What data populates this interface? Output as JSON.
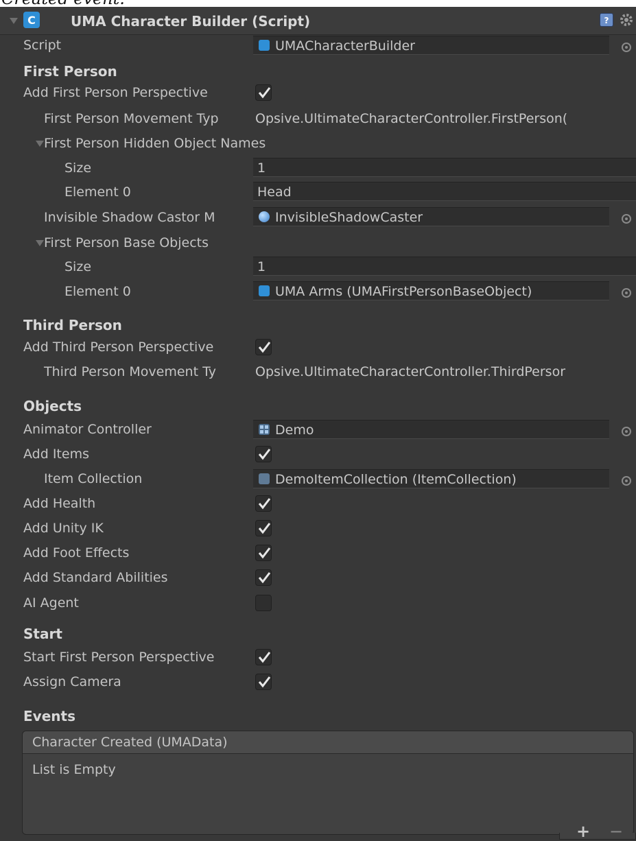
{
  "caption": "Created event.",
  "header": {
    "title": "UMA Character Builder (Script)",
    "icons": [
      "collapse-arrow-icon",
      "script-icon",
      "help-icon",
      "gear-icon"
    ]
  },
  "fields": {
    "script": {
      "label": "Script",
      "value": "UMACharacterBuilder"
    }
  },
  "first_person": {
    "heading": "First Person",
    "add_perspective_label": "Add First Person Perspective",
    "add_perspective_checked": true,
    "movement_type_label": "First Person Movement Typ",
    "movement_type_value": "Opsive.UltimateCharacterController.FirstPerson(",
    "hidden_names_label": "First Person Hidden Object Names",
    "hidden_size_label": "Size",
    "hidden_size_value": "1",
    "hidden_element_label": "Element 0",
    "hidden_element_value": "Head",
    "shadow_label": "Invisible Shadow Castor M",
    "shadow_value": "InvisibleShadowCaster",
    "base_objects_label": "First Person Base Objects",
    "base_size_label": "Size",
    "base_size_value": "1",
    "base_element_label": "Element 0",
    "base_element_value": "UMA Arms (UMAFirstPersonBaseObject)"
  },
  "third_person": {
    "heading": "Third Person",
    "add_perspective_label": "Add Third Person Perspective",
    "add_perspective_checked": true,
    "movement_type_label": "Third Person Movement Ty",
    "movement_type_value": "Opsive.UltimateCharacterController.ThirdPersor"
  },
  "objects": {
    "heading": "Objects",
    "animator_label": "Animator Controller",
    "animator_value": "Demo",
    "add_items_label": "Add Items",
    "add_items_checked": true,
    "item_collection_label": "Item Collection",
    "item_collection_value": "DemoItemCollection (ItemCollection)",
    "add_health_label": "Add Health",
    "add_health_checked": true,
    "add_unity_ik_label": "Add Unity IK",
    "add_unity_ik_checked": true,
    "add_foot_effects_label": "Add Foot Effects",
    "add_foot_effects_checked": true,
    "add_standard_abilities_label": "Add Standard Abilities",
    "add_standard_abilities_checked": true,
    "ai_agent_label": "AI Agent",
    "ai_agent_checked": false
  },
  "start": {
    "heading": "Start",
    "start_fp_label": "Start First Person Perspective",
    "start_fp_checked": true,
    "assign_camera_label": "Assign Camera",
    "assign_camera_checked": true
  },
  "events": {
    "heading": "Events",
    "list_title": "Character Created (UMAData)",
    "empty_text": "List is Empty",
    "add_label": "+",
    "remove_label": "−"
  },
  "colors": {
    "checkmark": "#e8e8e8",
    "script_icon": "#2f8fd6",
    "material_icon": "#5aa0e6",
    "panel_bg": "#383838"
  }
}
